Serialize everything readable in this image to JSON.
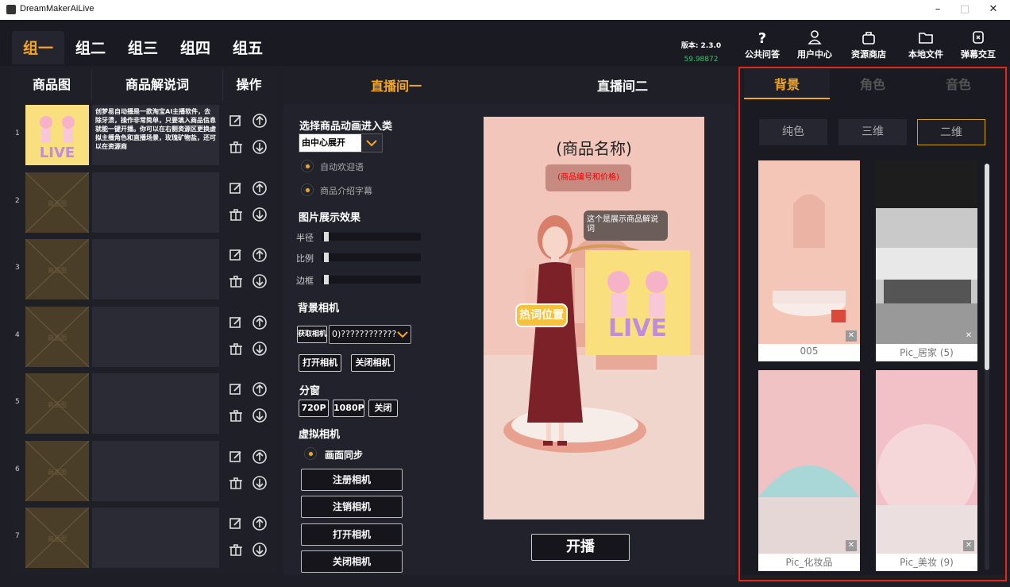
{
  "window": {
    "title": "DreamMakerAiLive",
    "minimize": "–",
    "maximize": "□",
    "close": "✕"
  },
  "topbar": {
    "groups": [
      "组一",
      "组二",
      "组三",
      "组四",
      "组五"
    ],
    "active_group": 0,
    "version_label": "版本: 2.3.0",
    "version_value": "59.98872",
    "actions": [
      {
        "label": "公共问答",
        "icon": "question-icon"
      },
      {
        "label": "用户中心",
        "icon": "user-icon"
      },
      {
        "label": "资源商店",
        "icon": "bag-icon"
      },
      {
        "label": "本地文件",
        "icon": "folder-icon"
      },
      {
        "label": "弹幕交互",
        "icon": "chat-icon"
      }
    ]
  },
  "product_panel": {
    "headers": [
      "商品图",
      "商品解说词",
      "操作"
    ],
    "rows": [
      {
        "num": "1",
        "desc": "创梦易自动播是一款淘宝AI主播软件，去除牙渍，操作非常简单，只要填入商品信息就能一键开播。你可以在右侧资源区更换虚拟主播角色和直播场景，玫瑰矿物盐，还可以在资源商",
        "has_image": true
      },
      {
        "num": "2",
        "desc": "",
        "has_image": false
      },
      {
        "num": "3",
        "desc": "",
        "has_image": false
      },
      {
        "num": "4",
        "desc": "",
        "has_image": false
      },
      {
        "num": "5",
        "desc": "",
        "has_image": false
      },
      {
        "num": "6",
        "desc": "",
        "has_image": false
      },
      {
        "num": "7",
        "desc": "",
        "has_image": false
      }
    ],
    "placeholder_label": "商品图"
  },
  "live_tabs": {
    "tab1": "直播间一",
    "tab2": "直播间二",
    "active_color": "#f5a623"
  },
  "controls": {
    "anim_label": "选择商品动画进入类",
    "anim_value": "由中心展开",
    "auto_welcome": "自动欢迎语",
    "intro_subtitle": "商品介绍字幕",
    "image_effect_label": "图片展示效果",
    "sliders": [
      {
        "label": "半径",
        "value": 0.0
      },
      {
        "label": "比例",
        "value": 0.0
      },
      {
        "label": "边框",
        "value": 0.0
      }
    ],
    "bg_camera_label": "背景相机",
    "get_camera": "获取相机",
    "camera_value": "0)????????????",
    "open_camera": "打开相机",
    "close_camera": "关闭相机",
    "split_label": "分窗",
    "split_720": "720P",
    "split_1080": "1080P",
    "split_close": "关闭",
    "virtual_camera_label": "虚拟相机",
    "screen_sync": "画面同步",
    "register_camera": "注册相机",
    "unregister_camera": "注销相机",
    "v_open_camera": "打开相机",
    "v_close_camera": "关闭相机"
  },
  "preview": {
    "product_name": "(商品名称)",
    "product_price": "(商品编号和价格)",
    "bubble": "这个是展示商品解说词",
    "hot_word": "热词位置"
  },
  "start_button": "开播",
  "resource_panel": {
    "tabs": [
      "背景",
      "角色",
      "音色"
    ],
    "active_tab": 0,
    "subtabs": [
      "纯色",
      "三维",
      "二维"
    ],
    "active_subtab": 2,
    "items": [
      {
        "caption": "005"
      },
      {
        "caption": "Pic_居家 (5)"
      },
      {
        "caption": "Pic_化妆品"
      },
      {
        "caption": "Pic_美妆 (9)"
      }
    ],
    "delete_icon": "✕"
  }
}
